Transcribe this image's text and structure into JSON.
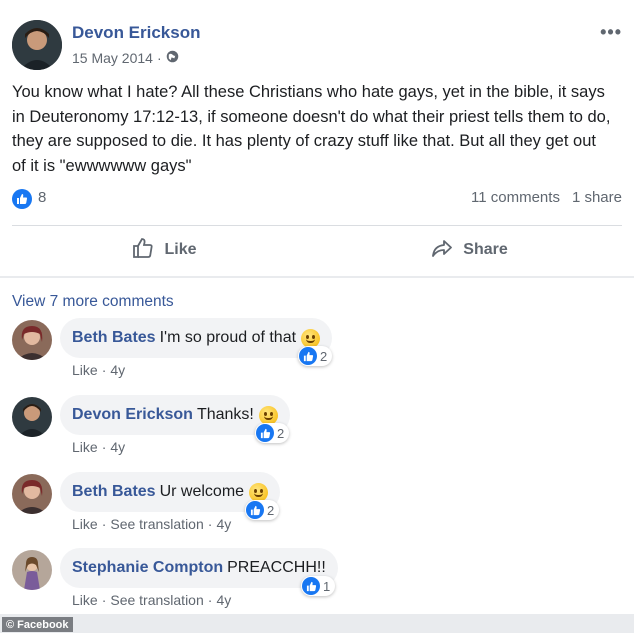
{
  "post": {
    "author": "Devon Erickson",
    "date": "15 May 2014",
    "privacy_icon": "globe-icon",
    "text": "You know what I hate? All these Christians who hate gays, yet in the bible, it says in Deuteronomy 17:12-13, if someone doesn't do what their priest tells them to do, they are supposed to die. It has plenty of crazy stuff like that. But all they get out of it is \"ewwwwww gays\"",
    "reaction_count": "8",
    "comments_count": "11 comments",
    "shares_count": "1 share"
  },
  "actions": {
    "like_label": "Like",
    "share_label": "Share"
  },
  "view_more_label": "View 7 more comments",
  "comments": [
    {
      "name": "Beth Bates",
      "text": "I'm so proud of that",
      "emoji": "slightly-smiling-face",
      "reactions": "2",
      "like": "Like",
      "translate": "",
      "age": "4y"
    },
    {
      "name": "Devon Erickson",
      "text": "Thanks!",
      "emoji": "grinning-face",
      "reactions": "2",
      "like": "Like",
      "translate": "",
      "age": "4y"
    },
    {
      "name": "Beth Bates",
      "text": "Ur welcome",
      "emoji": "winking-face",
      "reactions": "2",
      "like": "Like",
      "translate": "See translation",
      "age": "4y"
    },
    {
      "name": "Stephanie Compton",
      "text": "PREACCHH!!",
      "emoji": "",
      "reactions": "1",
      "like": "Like",
      "translate": "See translation",
      "age": "4y"
    }
  ],
  "sep": "·",
  "watermark": "© Facebook",
  "colors": {
    "link": "#385898",
    "like_blue": "#1877f2",
    "muted": "#606770",
    "bubble": "#f2f3f5"
  }
}
